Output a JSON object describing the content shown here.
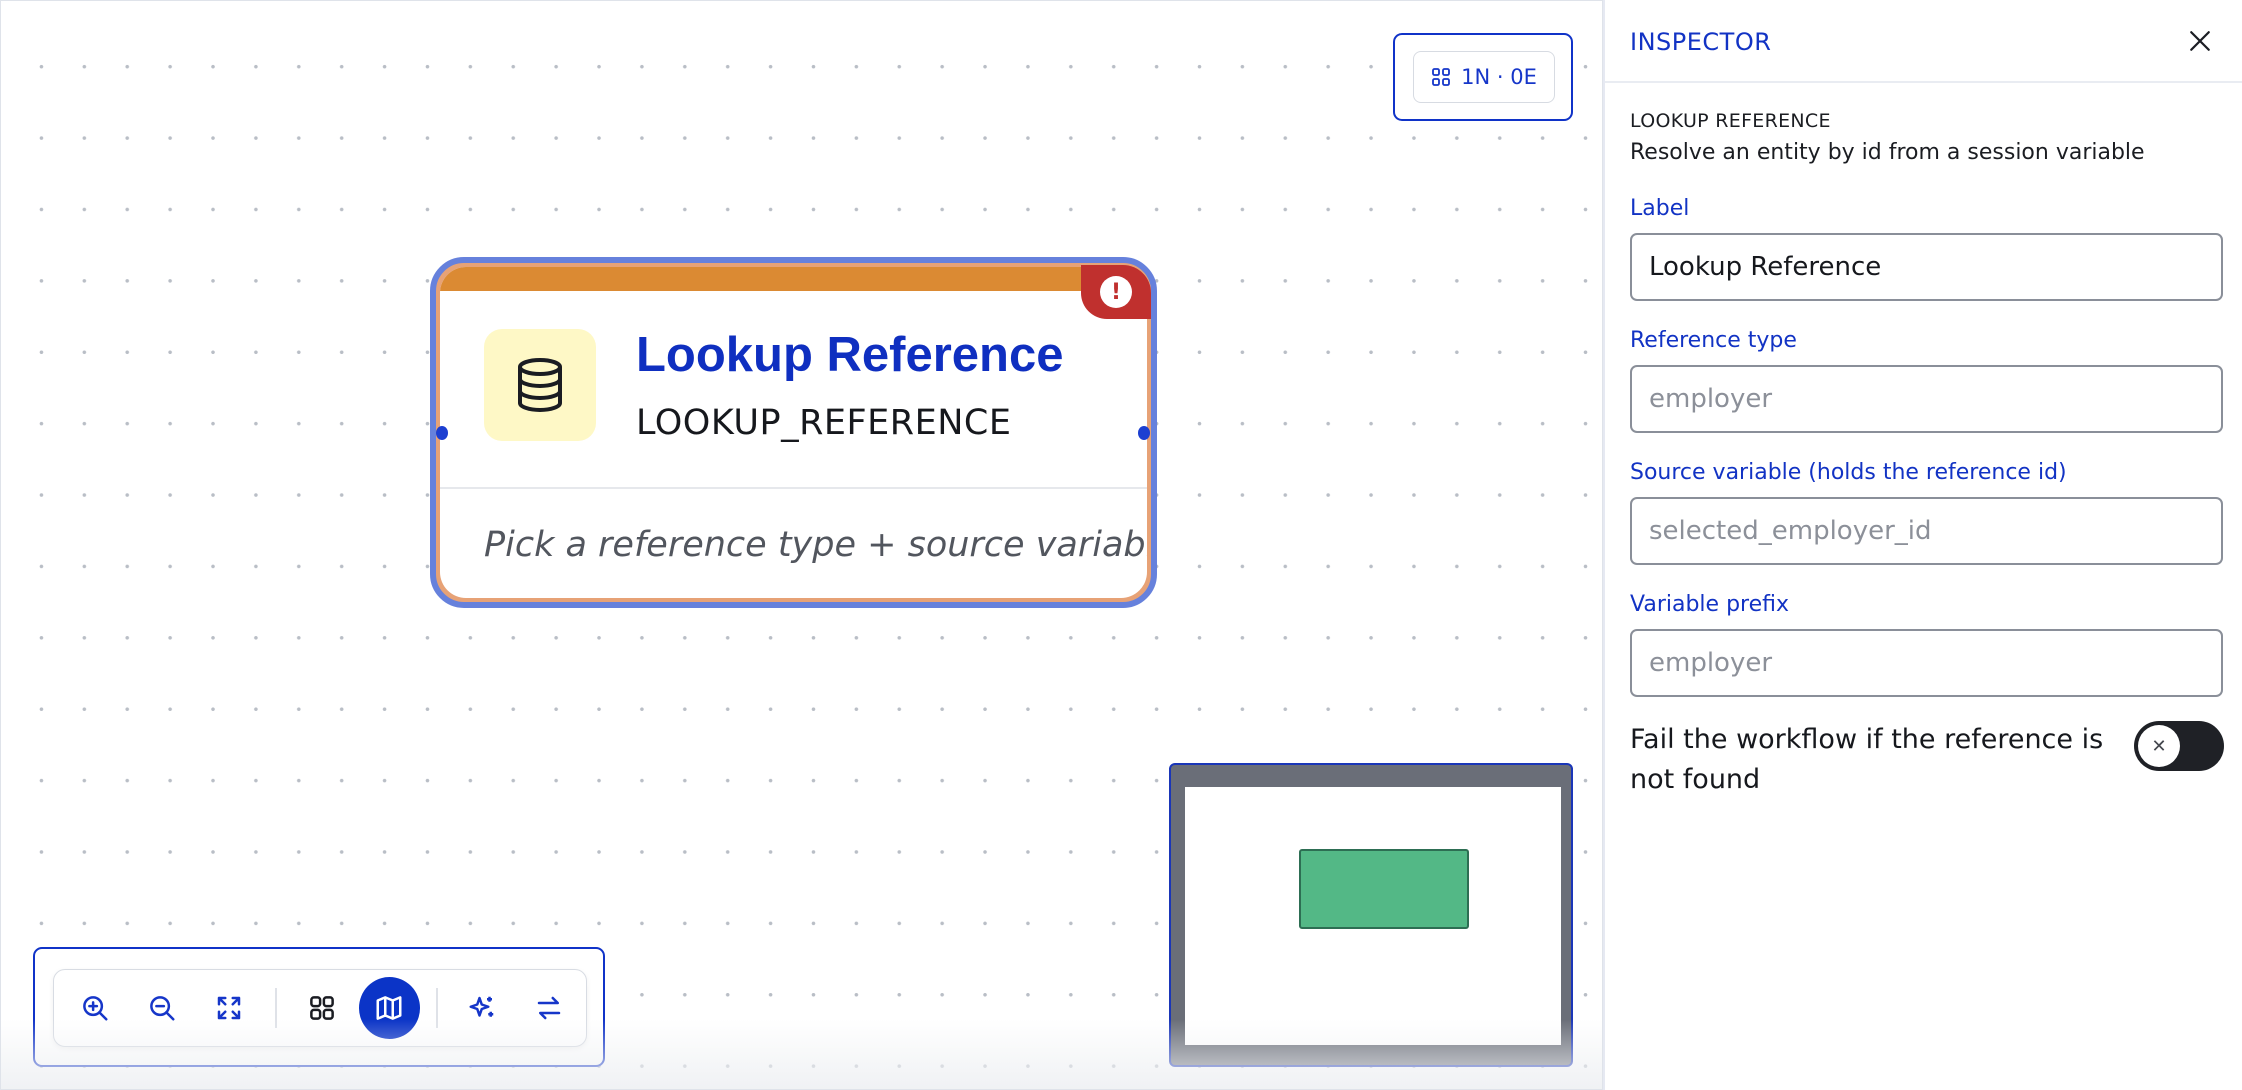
{
  "canvas": {
    "stats": {
      "label": "1N · 0E",
      "icon": "grid-icon"
    },
    "node": {
      "title": "Lookup Reference",
      "type": "LOOKUP_REFERENCE",
      "hint": "Pick a reference type + source variable",
      "icon": "database-icon",
      "error_badge": "!",
      "colors": {
        "top_bar": "#db8a33",
        "selection_ring": "#6681dc",
        "icon_bg": "#fef8c6",
        "error": "#c0302e"
      }
    },
    "minimap": {
      "node_color": "#53b886"
    },
    "toolbar": {
      "buttons": [
        {
          "icon": "zoom-in-icon"
        },
        {
          "icon": "zoom-out-icon"
        },
        {
          "icon": "fit-view-icon"
        },
        {
          "icon": "grid-layout-icon"
        },
        {
          "icon": "map-icon",
          "active": true
        },
        {
          "icon": "sparkles-icon"
        },
        {
          "icon": "swap-arrows-icon"
        }
      ],
      "accent": "#0b34c7"
    }
  },
  "inspector": {
    "title": "INSPECTOR",
    "kind": "LOOKUP REFERENCE",
    "description": "Resolve an entity by id from a session variable",
    "fields": {
      "label": {
        "label": "Label",
        "value": "Lookup Reference",
        "placeholder": ""
      },
      "reference_type": {
        "label": "Reference type",
        "value": "",
        "placeholder": "employer"
      },
      "source_variable": {
        "label": "Source variable (holds the reference id)",
        "value": "",
        "placeholder": "selected_employer_id"
      },
      "variable_prefix": {
        "label": "Variable prefix",
        "value": "",
        "placeholder": "employer"
      }
    },
    "fail_toggle": {
      "label": "Fail the workflow if the reference is not found",
      "on": false,
      "knob_glyph": "✕"
    }
  }
}
